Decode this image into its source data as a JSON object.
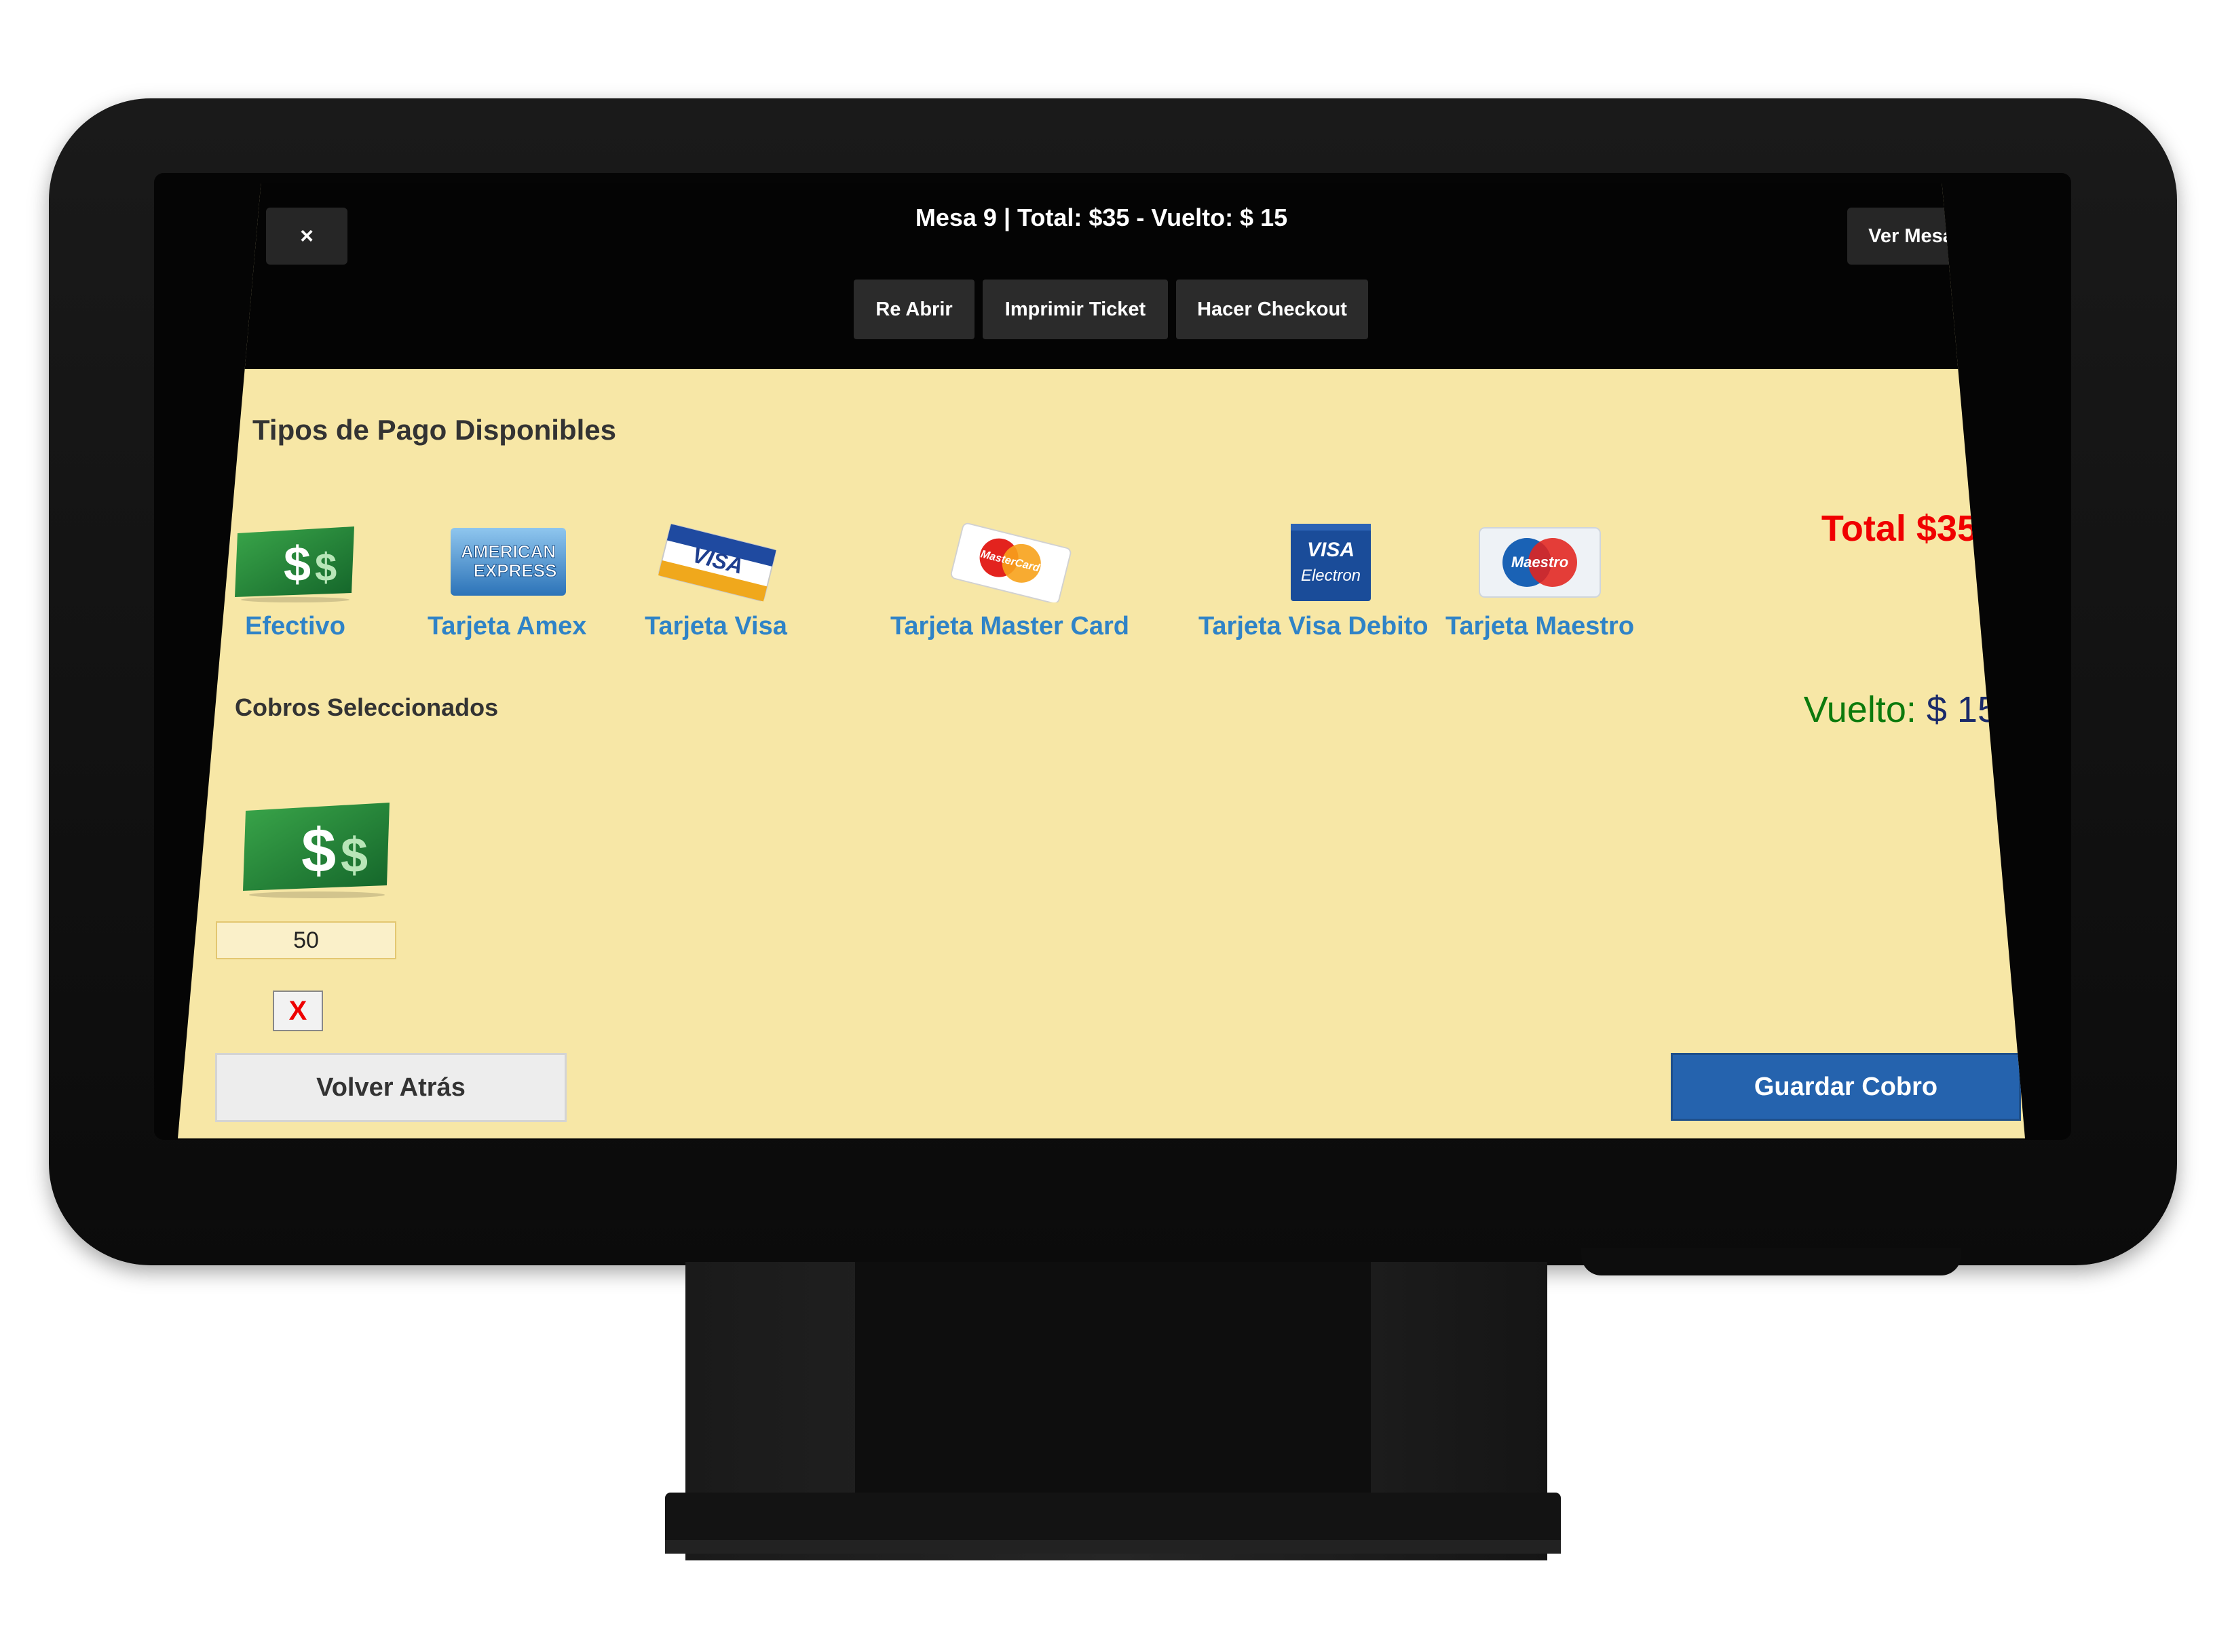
{
  "header": {
    "close_icon_glyph": "×",
    "title": "Mesa 9 | Total: $35 - Vuelto: $ 15",
    "ver_mesa": "Ver Mesa",
    "actions": [
      "Re Abrir",
      "Imprimir Ticket",
      "Hacer Checkout"
    ]
  },
  "payment_types": {
    "heading": "Tipos de Pago Disponibles",
    "items": [
      {
        "label": "Efectivo",
        "icon": "cash-icon"
      },
      {
        "label": "Tarjeta Amex",
        "icon": "amex-card-icon",
        "card_text": [
          "AMERICAN",
          "EXPRESS"
        ]
      },
      {
        "label": "Tarjeta Visa",
        "icon": "visa-card-icon",
        "card_text": "VISA"
      },
      {
        "label": "Tarjeta Master Card",
        "icon": "mastercard-icon",
        "card_text": "MasterCard"
      },
      {
        "label": "Tarjeta Visa Debito",
        "icon": "visa-electron-icon",
        "card_text": [
          "VISA",
          "Electron"
        ]
      },
      {
        "label": "Tarjeta Maestro",
        "icon": "maestro-card-icon",
        "card_text": "Maestro"
      }
    ]
  },
  "summary": {
    "total": "Total $35",
    "vuelto_label": "Vuelto: ",
    "vuelto_amount": "$ 15"
  },
  "selected": {
    "heading": "Cobros Seleccionados",
    "items": [
      {
        "icon": "cash-icon",
        "amount": "50",
        "remove_glyph": "X"
      }
    ]
  },
  "footer": {
    "back": "Volver Atrás",
    "save": "Guardar Cobro"
  },
  "colors": {
    "screen_bg": "#f7e7a6",
    "link_blue": "#2f83c7",
    "total_red": "#f00000",
    "vuelto_green": "#0c7a0c",
    "primary_button": "#2563ae"
  }
}
